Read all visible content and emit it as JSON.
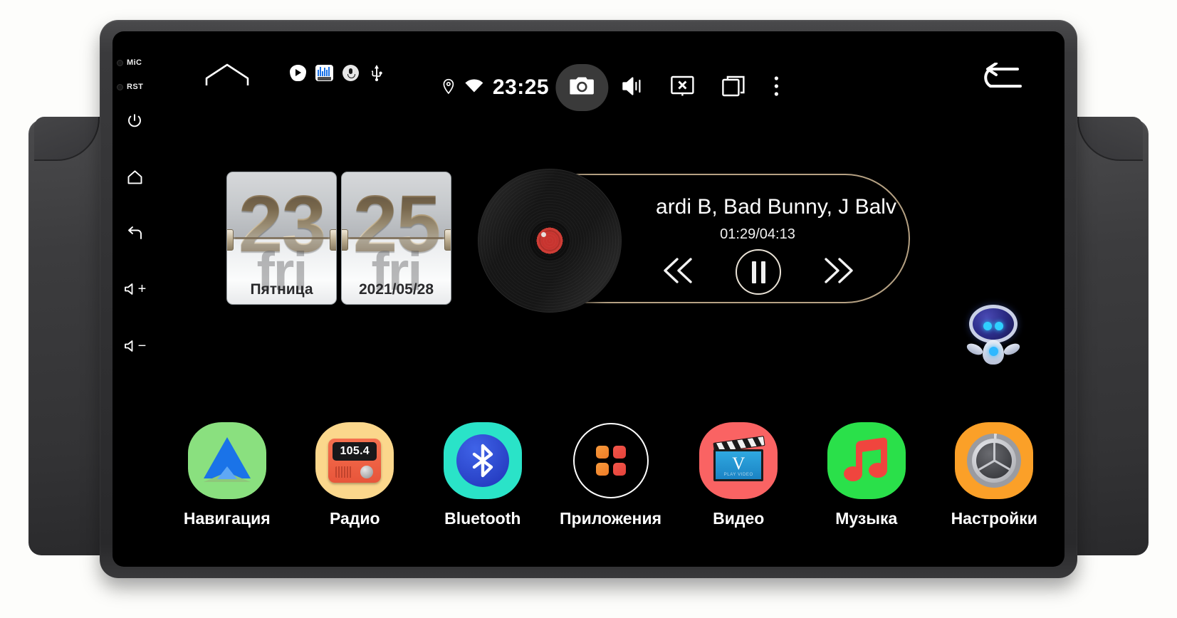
{
  "device": {
    "indicators": [
      {
        "name": "mic",
        "label": "MiC"
      },
      {
        "name": "rst",
        "label": "RST"
      }
    ],
    "hard_buttons": [
      {
        "name": "power",
        "icon": "power-icon",
        "label": ""
      },
      {
        "name": "home",
        "icon": "home-icon",
        "label": ""
      },
      {
        "name": "back",
        "icon": "back-icon",
        "label": ""
      },
      {
        "name": "volume-up",
        "icon": "volume-icon",
        "label": "+"
      },
      {
        "name": "volume-down",
        "icon": "volume-icon",
        "label": "−"
      }
    ]
  },
  "statusbar": {
    "time": "23:25",
    "icons": [
      {
        "name": "location-icon"
      },
      {
        "name": "wifi-icon"
      },
      {
        "name": "screenshot-icon"
      },
      {
        "name": "mute-icon"
      },
      {
        "name": "screen-off-icon"
      },
      {
        "name": "recent-apps-icon"
      },
      {
        "name": "overflow-menu-icon"
      },
      {
        "name": "back-arrow-icon"
      }
    ],
    "tray": [
      {
        "name": "play-services-icon"
      },
      {
        "name": "equalizer-icon"
      },
      {
        "name": "voice-assistant-icon"
      },
      {
        "name": "usb-icon"
      }
    ]
  },
  "clock_widget": {
    "hours": "23",
    "minutes": "25",
    "weekday": "Пятница",
    "date": "2021/05/28",
    "watermark": "fri"
  },
  "music_widget": {
    "track_title": "ardi B, Bad Bunny, J Balv",
    "time": "01:29/04:13",
    "controls": [
      {
        "name": "previous-track-button",
        "glyph": "⏮"
      },
      {
        "name": "play-pause-button",
        "glyph": "⏸"
      },
      {
        "name": "next-track-button",
        "glyph": "⏭"
      }
    ]
  },
  "assistant": {
    "name": "assistant-robot-icon"
  },
  "dock": {
    "apps": [
      {
        "name": "navigation",
        "label": "Навигация",
        "tile_color": "#8ae07f",
        "icon": "navigation-arrow-icon"
      },
      {
        "name": "radio",
        "label": "Радио",
        "tile_color": "#fbd78c",
        "icon": "radio-icon",
        "frequency": "105.4"
      },
      {
        "name": "bluetooth",
        "label": "Bluetooth",
        "tile_color": "#2ae3c8",
        "icon": "bluetooth-icon"
      },
      {
        "name": "applications",
        "label": "Приложения",
        "tile_color": "transparent",
        "icon": "apps-grid-icon"
      },
      {
        "name": "video",
        "label": "Видео",
        "tile_color": "#fa6363",
        "icon": "video-clapper-icon",
        "badge": "V",
        "badge_sub": "PLAY VIDEO"
      },
      {
        "name": "music",
        "label": "Музыка",
        "tile_color": "#2ae04a",
        "icon": "music-note-icon"
      },
      {
        "name": "settings",
        "label": "Настройки",
        "tile_color": "#fba028",
        "icon": "settings-gear-icon"
      }
    ]
  },
  "colors": {
    "screen_bg": "#000000",
    "accent_gold": "#b5a183",
    "bezel": "#313133"
  }
}
